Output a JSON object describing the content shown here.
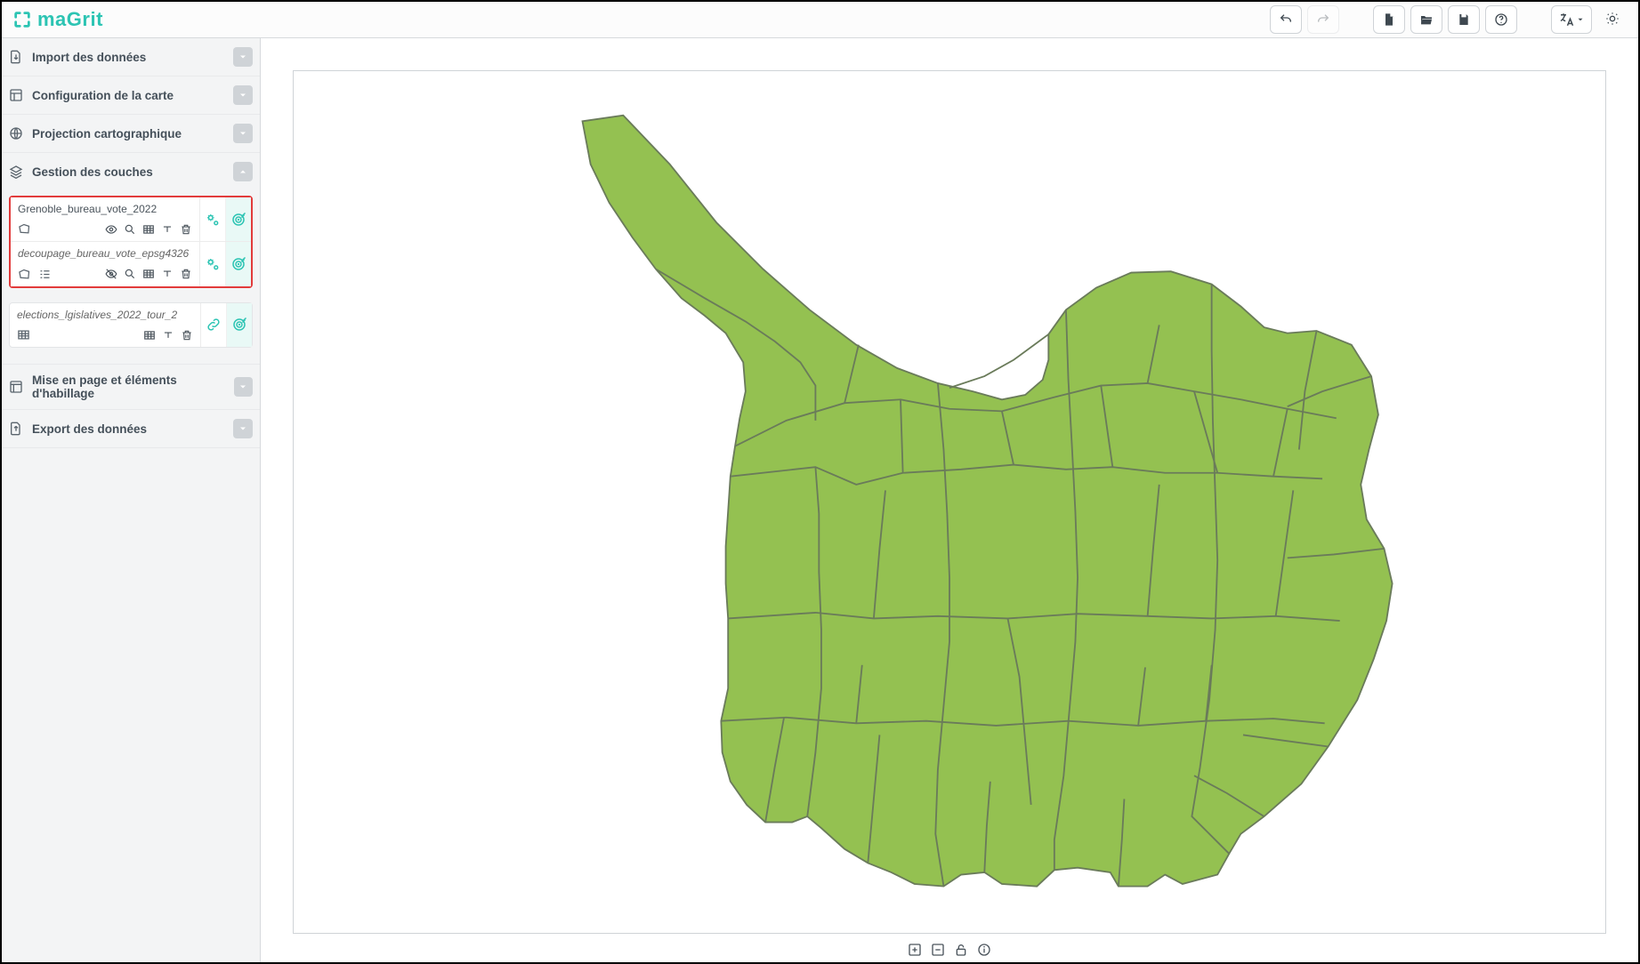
{
  "app": {
    "name": "maGrit"
  },
  "toolbar": {
    "undo": "undo",
    "redo": "redo",
    "new": "new-file",
    "open": "open-folder",
    "save": "save",
    "help": "help",
    "language": "language",
    "settings": "settings"
  },
  "sidebar": {
    "sections": [
      {
        "id": "import",
        "label": "Import des données",
        "expanded": false
      },
      {
        "id": "config",
        "label": "Configuration de la carte",
        "expanded": false
      },
      {
        "id": "projection",
        "label": "Projection cartographique",
        "expanded": false
      },
      {
        "id": "layers",
        "label": "Gestion des couches",
        "expanded": true
      },
      {
        "id": "layout",
        "label": "Mise en page et éléments d'habillage",
        "expanded": false
      },
      {
        "id": "export",
        "label": "Export des données",
        "expanded": false
      }
    ],
    "layers_panel": {
      "layers": [
        {
          "name": "Grenoble_bureau_vote_2022",
          "kind": "polygon",
          "has_legend": false,
          "visible": true,
          "name_style": "strong",
          "tools": [
            "visibility",
            "zoom",
            "table",
            "typing",
            "delete"
          ],
          "actions": [
            "settings",
            "target"
          ]
        },
        {
          "name": "decoupage_bureau_vote_epsg4326",
          "kind": "polygon",
          "has_legend": true,
          "visible": false,
          "name_style": "italic",
          "tools": [
            "visibility",
            "zoom",
            "table",
            "typing",
            "delete"
          ],
          "actions": [
            "settings",
            "target"
          ]
        },
        {
          "name": "elections_lgislatives_2022_tour_2",
          "kind": "table",
          "has_legend": false,
          "visible": true,
          "name_style": "italic",
          "tools": [
            "table",
            "typing",
            "delete"
          ],
          "actions": [
            "link",
            "target"
          ]
        }
      ]
    }
  },
  "map": {
    "fill": "#94c151",
    "stroke": "#6a7b5a",
    "controls": [
      "zoom-in",
      "zoom-out",
      "lock",
      "info"
    ]
  }
}
